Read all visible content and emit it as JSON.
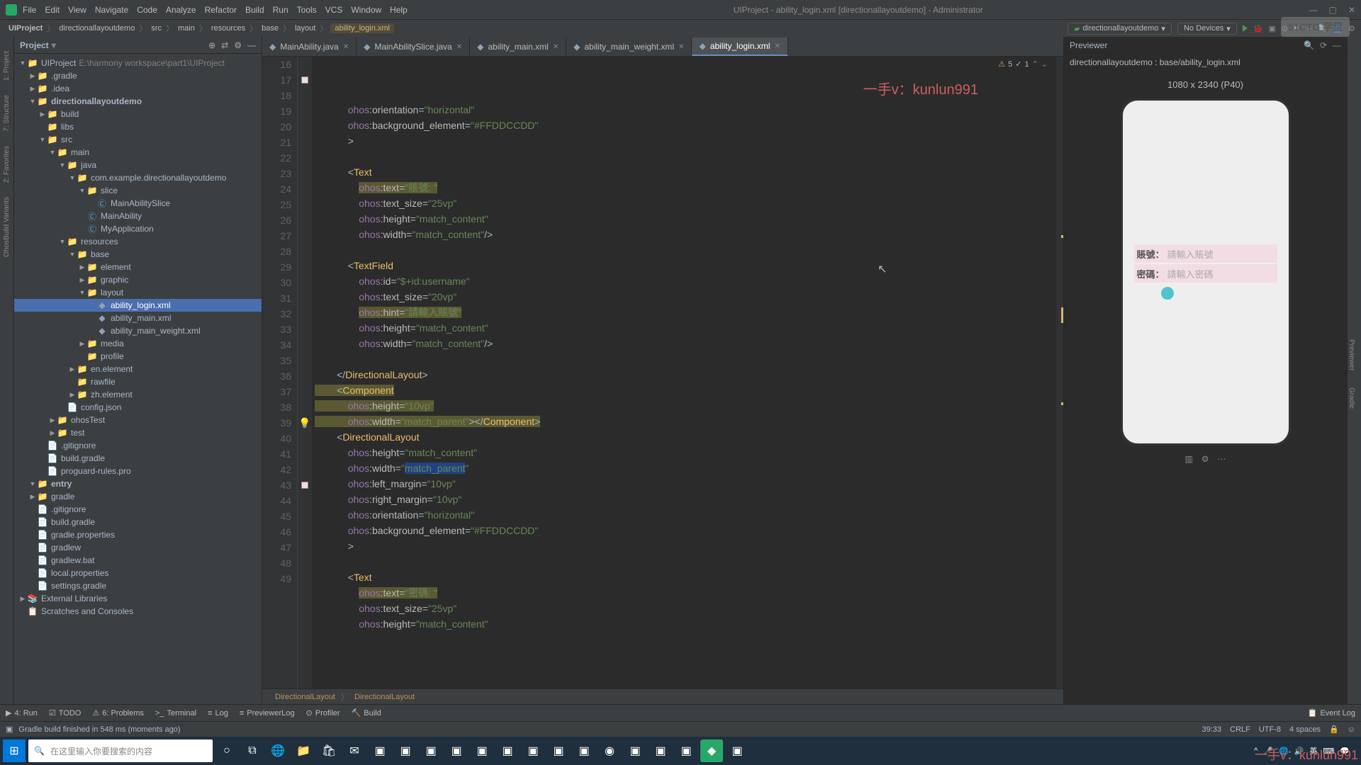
{
  "title": "UIProject - ability_login.xml [directionallayoutdemo] - Administrator",
  "menu": [
    "File",
    "Edit",
    "View",
    "Navigate",
    "Code",
    "Analyze",
    "Refactor",
    "Build",
    "Run",
    "Tools",
    "VCS",
    "Window",
    "Help"
  ],
  "watermark": "51CTO 学堂",
  "breadcrumb": {
    "items": [
      "UIProject",
      "directionallayoutdemo",
      "src",
      "main",
      "resources",
      "base",
      "layout"
    ],
    "file": "ability_login.xml"
  },
  "run_config": "directionallayoutdemo",
  "device_select": "No Devices",
  "project_header": "Project",
  "tree": [
    {
      "depth": 0,
      "arrow": "▼",
      "icon": "📁",
      "label": "UIProject",
      "hint": "E:\\harmony workspace\\part1\\UIProject",
      "sel": false
    },
    {
      "depth": 1,
      "arrow": "▶",
      "icon": "📁",
      "label": ".gradle",
      "sel": false
    },
    {
      "depth": 1,
      "arrow": "▶",
      "icon": "📁",
      "label": ".idea",
      "sel": false
    },
    {
      "depth": 1,
      "arrow": "▼",
      "icon": "📁",
      "label": "directionallayoutdemo",
      "sel": false,
      "bold": true
    },
    {
      "depth": 2,
      "arrow": "▶",
      "icon": "📁",
      "label": "build",
      "sel": false
    },
    {
      "depth": 2,
      "arrow": " ",
      "icon": "📁",
      "label": "libs",
      "sel": false
    },
    {
      "depth": 2,
      "arrow": "▼",
      "icon": "📁",
      "label": "src",
      "sel": false
    },
    {
      "depth": 3,
      "arrow": "▼",
      "icon": "📁",
      "label": "main",
      "sel": false
    },
    {
      "depth": 4,
      "arrow": "▼",
      "icon": "📁",
      "label": "java",
      "sel": false
    },
    {
      "depth": 5,
      "arrow": "▼",
      "icon": "📁",
      "label": "com.example.directionallayoutdemo",
      "sel": false
    },
    {
      "depth": 6,
      "arrow": "▼",
      "icon": "📁",
      "label": "slice",
      "sel": false
    },
    {
      "depth": 7,
      "arrow": " ",
      "icon": "Ⓒ",
      "label": "MainAbilitySlice",
      "sel": false,
      "blue": true
    },
    {
      "depth": 6,
      "arrow": " ",
      "icon": "Ⓒ",
      "label": "MainAbility",
      "sel": false,
      "blue": true
    },
    {
      "depth": 6,
      "arrow": " ",
      "icon": "Ⓒ",
      "label": "MyApplication",
      "sel": false,
      "blue": true
    },
    {
      "depth": 4,
      "arrow": "▼",
      "icon": "📁",
      "label": "resources",
      "sel": false
    },
    {
      "depth": 5,
      "arrow": "▼",
      "icon": "📁",
      "label": "base",
      "sel": false
    },
    {
      "depth": 6,
      "arrow": "▶",
      "icon": "📁",
      "label": "element",
      "sel": false
    },
    {
      "depth": 6,
      "arrow": "▶",
      "icon": "📁",
      "label": "graphic",
      "sel": false
    },
    {
      "depth": 6,
      "arrow": "▼",
      "icon": "📁",
      "label": "layout",
      "sel": false
    },
    {
      "depth": 7,
      "arrow": " ",
      "icon": "◆",
      "label": "ability_login.xml",
      "sel": true
    },
    {
      "depth": 7,
      "arrow": " ",
      "icon": "◆",
      "label": "ability_main.xml",
      "sel": false
    },
    {
      "depth": 7,
      "arrow": " ",
      "icon": "◆",
      "label": "ability_main_weight.xml",
      "sel": false
    },
    {
      "depth": 6,
      "arrow": "▶",
      "icon": "📁",
      "label": "media",
      "sel": false
    },
    {
      "depth": 6,
      "arrow": " ",
      "icon": "📁",
      "label": "profile",
      "sel": false
    },
    {
      "depth": 5,
      "arrow": "▶",
      "icon": "📁",
      "label": "en.element",
      "sel": false
    },
    {
      "depth": 5,
      "arrow": " ",
      "icon": "📁",
      "label": "rawfile",
      "sel": false
    },
    {
      "depth": 5,
      "arrow": "▶",
      "icon": "📁",
      "label": "zh.element",
      "sel": false
    },
    {
      "depth": 4,
      "arrow": " ",
      "icon": "📄",
      "label": "config.json",
      "sel": false
    },
    {
      "depth": 3,
      "arrow": "▶",
      "icon": "📁",
      "label": "ohosTest",
      "sel": false
    },
    {
      "depth": 3,
      "arrow": "▶",
      "icon": "📁",
      "label": "test",
      "sel": false
    },
    {
      "depth": 2,
      "arrow": " ",
      "icon": "📄",
      "label": ".gitignore",
      "sel": false
    },
    {
      "depth": 2,
      "arrow": " ",
      "icon": "📄",
      "label": "build.gradle",
      "sel": false
    },
    {
      "depth": 2,
      "arrow": " ",
      "icon": "📄",
      "label": "proguard-rules.pro",
      "sel": false
    },
    {
      "depth": 1,
      "arrow": "▼",
      "icon": "📁",
      "label": "entry",
      "sel": false,
      "bold": true
    },
    {
      "depth": 1,
      "arrow": "▶",
      "icon": "📁",
      "label": "gradle",
      "sel": false
    },
    {
      "depth": 1,
      "arrow": " ",
      "icon": "📄",
      "label": ".gitignore",
      "sel": false
    },
    {
      "depth": 1,
      "arrow": " ",
      "icon": "📄",
      "label": "build.gradle",
      "sel": false
    },
    {
      "depth": 1,
      "arrow": " ",
      "icon": "📄",
      "label": "gradle.properties",
      "sel": false
    },
    {
      "depth": 1,
      "arrow": " ",
      "icon": "📄",
      "label": "gradlew",
      "sel": false
    },
    {
      "depth": 1,
      "arrow": " ",
      "icon": "📄",
      "label": "gradlew.bat",
      "sel": false
    },
    {
      "depth": 1,
      "arrow": " ",
      "icon": "📄",
      "label": "local.properties",
      "sel": false
    },
    {
      "depth": 1,
      "arrow": " ",
      "icon": "📄",
      "label": "settings.gradle",
      "sel": false
    },
    {
      "depth": 0,
      "arrow": "▶",
      "icon": "📚",
      "label": "External Libraries",
      "sel": false
    },
    {
      "depth": 0,
      "arrow": " ",
      "icon": "📋",
      "label": "Scratches and Consoles",
      "sel": false
    }
  ],
  "tabs": [
    {
      "label": "MainAbility.java",
      "active": false
    },
    {
      "label": "MainAbilitySlice.java",
      "active": false
    },
    {
      "label": "ability_main.xml",
      "active": false
    },
    {
      "label": "ability_main_weight.xml",
      "active": false
    },
    {
      "label": "ability_login.xml",
      "active": true
    }
  ],
  "line_start": 16,
  "line_end": 49,
  "editor_warnings": {
    "warn": "5",
    "err": "1"
  },
  "breadcrumb_bottom": [
    "DirectionalLayout",
    "DirectionalLayout"
  ],
  "overlay1": "一手v：kunlun991",
  "overlay2": "一手v：kunlun991",
  "preview": {
    "title": "Previewer",
    "path": "directionallayoutdemo : base/ability_login.xml",
    "device": "1080 x 2340 (P40)",
    "rows": [
      {
        "label": "賬號：",
        "placeholder": "請輸入賬號"
      },
      {
        "label": "密碼：",
        "placeholder": "請輸入密碼"
      }
    ]
  },
  "bottom_tools": [
    {
      "icon": "▶",
      "label": "4: Run"
    },
    {
      "icon": "☑",
      "label": "TODO"
    },
    {
      "icon": "⚠",
      "label": "6: Problems"
    },
    {
      "icon": ">_",
      "label": "Terminal"
    },
    {
      "icon": "≡",
      "label": "Log"
    },
    {
      "icon": "≡",
      "label": "PreviewerLog"
    },
    {
      "icon": "⊙",
      "label": "Profiler"
    },
    {
      "icon": "🔨",
      "label": "Build"
    }
  ],
  "event_log": "Event Log",
  "status_msg": "Gradle build finished in 548 ms (moments ago)",
  "status_right": {
    "pos": "39:33",
    "le": "CRLF",
    "enc": "UTF-8",
    "indent": "4 spaces"
  },
  "taskbar_search": "在这里输入你要搜索的内容",
  "taskbar_time": " "
}
